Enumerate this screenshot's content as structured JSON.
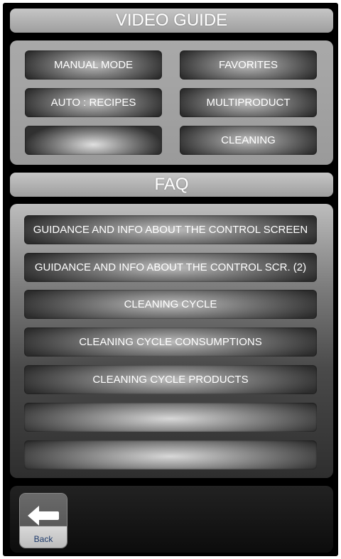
{
  "video_guide": {
    "title": "VIDEO GUIDE",
    "buttons": [
      "MANUAL MODE",
      "FAVORITES",
      "AUTO : RECIPES",
      "MULTIPRODUCT",
      "",
      "CLEANING"
    ]
  },
  "faq": {
    "title": "FAQ",
    "items": [
      "GUIDANCE AND INFO ABOUT THE CONTROL SCREEN",
      "GUIDANCE AND INFO ABOUT THE CONTROL SCR. (2)",
      "CLEANING CYCLE",
      "CLEANING CYCLE CONSUMPTIONS",
      "CLEANING CYCLE PRODUCTS",
      "",
      ""
    ]
  },
  "footer": {
    "back_label": "Back",
    "back_icon": "back-arrow-icon"
  }
}
